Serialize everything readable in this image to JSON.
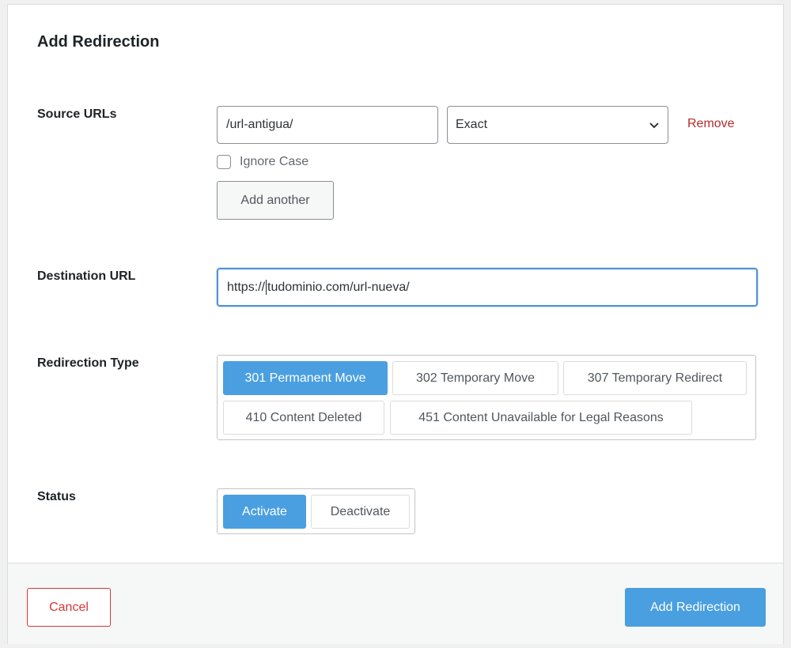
{
  "dialog": {
    "title": "Add Redirection"
  },
  "source": {
    "label": "Source URLs",
    "url_value": "/url-antigua/",
    "match_type": "Exact",
    "remove_label": "Remove",
    "ignore_case_label": "Ignore Case",
    "ignore_case_checked": false,
    "add_another_label": "Add another"
  },
  "destination": {
    "label": "Destination URL",
    "value_before_cursor": "https://",
    "value_after_cursor": "tudominio.com/url-nueva/"
  },
  "redirection_type": {
    "label": "Redirection Type",
    "options": [
      "301 Permanent Move",
      "302 Temporary Move",
      "307 Temporary Redirect",
      "410 Content Deleted",
      "451 Content Unavailable for Legal Reasons"
    ],
    "selected": "301 Permanent Move"
  },
  "status": {
    "label": "Status",
    "options": [
      "Activate",
      "Deactivate"
    ],
    "selected": "Activate"
  },
  "footer": {
    "cancel_label": "Cancel",
    "submit_label": "Add Redirection"
  },
  "colors": {
    "accent": "#4a9fe0",
    "danger": "#b32d2e",
    "cancel": "#d63638"
  },
  "icons": {
    "select_arrow": "chevron-down-icon"
  }
}
